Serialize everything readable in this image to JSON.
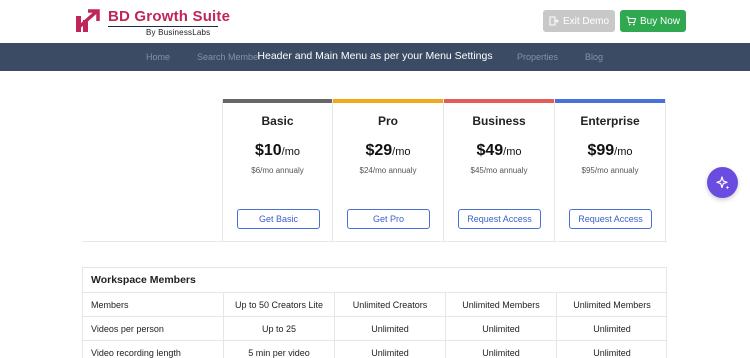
{
  "brand": {
    "title": "BD Growth Suite",
    "subtitle": "By BusinessLabs",
    "accent": "#c0265a"
  },
  "header": {
    "exit_demo": "Exit Demo",
    "exit_icon": "exit-icon",
    "buy_now": "Buy Now",
    "buy_icon": "cart-icon",
    "buy_color": "#2fa84f"
  },
  "nav": {
    "items": [
      "Home",
      "Search Member",
      "Properties",
      "Blog"
    ],
    "note": "Header and Main Menu as per your Menu Settings",
    "background": "#3a4b63"
  },
  "plans": [
    {
      "name": "Basic",
      "price": "$10",
      "per": "/mo",
      "annual": "$6/mo annualy",
      "button": "Get Basic",
      "color": "#666666"
    },
    {
      "name": "Pro",
      "price": "$29",
      "per": "/mo",
      "annual": "$24/mo annualy",
      "button": "Get Pro",
      "color": "#f2a81d"
    },
    {
      "name": "Business",
      "price": "$49",
      "per": "/mo",
      "annual": "$45/mo annualy",
      "button": "Request Access",
      "color": "#e35d5d"
    },
    {
      "name": "Enterprise",
      "price": "$99",
      "per": "/mo",
      "annual": "$95/mo annualy",
      "button": "Request Access",
      "color": "#4a6fd6"
    }
  ],
  "features": {
    "section_title": "Workspace Members",
    "rows": [
      {
        "label": "Members",
        "values": [
          "Up to 50 Creators Lite",
          "Unlimited Creators",
          "Unlimited Members",
          "Unlimited Members"
        ]
      },
      {
        "label": "Videos per person",
        "values": [
          "Up to 25",
          "Unlimited",
          "Unlimited",
          "Unlimited"
        ]
      },
      {
        "label": "Video recording length",
        "values": [
          "5 min per video",
          "Unlimited",
          "Unlimited",
          "Unlimited"
        ]
      }
    ]
  },
  "fab": {
    "icon": "sparkle-icon",
    "color": "#6a4de0"
  }
}
